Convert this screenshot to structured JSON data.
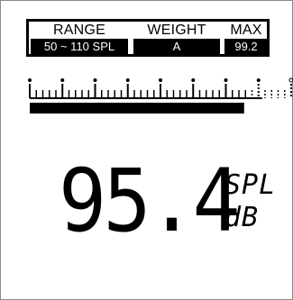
{
  "header": {
    "range_label": "RANGE",
    "range_value": "50 ~ 110 SPL",
    "weight_label": "WEIGHT",
    "weight_value": "A",
    "max_label": "MAX",
    "max_value": "99.2"
  },
  "bar_graph": {
    "level_fraction": 0.82,
    "major_ticks": 8
  },
  "reading": {
    "value": "95.4",
    "unit_top": "SPL",
    "unit_bottom": "dB"
  },
  "colors": {
    "foreground": "#000000",
    "background": "#ffffff"
  }
}
